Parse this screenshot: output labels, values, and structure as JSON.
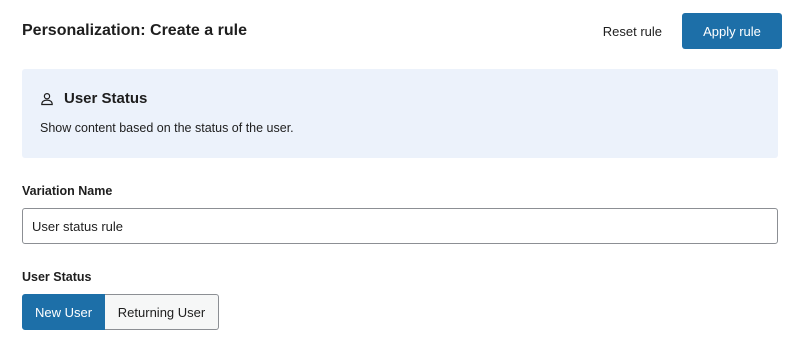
{
  "header": {
    "title": "Personalization: Create a rule",
    "reset_label": "Reset rule",
    "apply_label": "Apply rule"
  },
  "info_panel": {
    "icon": "user-icon",
    "title": "User Status",
    "description": "Show content based on the status of the user."
  },
  "variation": {
    "label": "Variation Name",
    "value": "User status rule"
  },
  "user_status": {
    "label": "User Status",
    "options": [
      "New User",
      "Returning User"
    ],
    "selected": "New User"
  },
  "colors": {
    "accent": "#1d6fa8",
    "panel_bg": "#ecf2fb"
  }
}
